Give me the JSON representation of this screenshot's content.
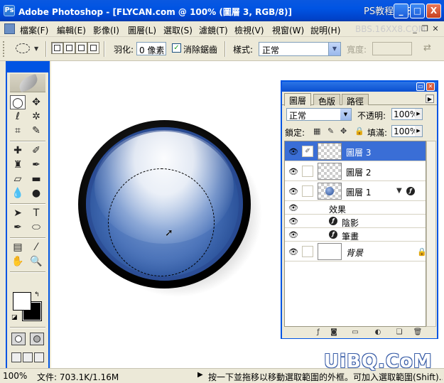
{
  "window": {
    "title": "Adobe Photoshop - [FLYCAN.com @ 100% (圖層 3, RGB/8)]",
    "app_icon": "Ps",
    "minimize": "_",
    "maximize": "□",
    "close": "X"
  },
  "watermarks": {
    "top": "PS教程论坛",
    "bbs": "BBS.16XX8.COM",
    "bottom": "UiBQ.CoM"
  },
  "menu": {
    "items": [
      "檔案(F)",
      "編輯(E)",
      "影像(I)",
      "圖層(L)",
      "選取(S)",
      "濾鏡(T)",
      "檢視(V)",
      "視窗(W)",
      "說明(H)"
    ]
  },
  "options": {
    "feather_label": "羽化:",
    "feather_value": "0 像素",
    "antialias_label": "消除鋸齒",
    "antialias_checked": true,
    "style_label": "樣式:",
    "style_value": "正常",
    "width_label": "寬度:",
    "width_value": ""
  },
  "layers_panel": {
    "tabs": [
      "圖層",
      "色版",
      "路徑"
    ],
    "active_tab": "圖層",
    "blend_mode": "正常",
    "opacity_label": "不透明:",
    "opacity_value": "100%",
    "lock_label": "鎖定:",
    "fill_label": "填滿:",
    "fill_value": "100%",
    "layers": [
      {
        "name": "圖層 3",
        "selected": true,
        "visible": true
      },
      {
        "name": "圖層 2",
        "selected": false,
        "visible": true
      },
      {
        "name": "圖層 1",
        "selected": false,
        "visible": true,
        "has_effects": true
      },
      {
        "name": "效果",
        "type": "effects-header"
      },
      {
        "name": "陰影",
        "type": "effect"
      },
      {
        "name": "筆畫",
        "type": "effect"
      },
      {
        "name": "背景",
        "selected": false,
        "visible": true,
        "locked": true
      }
    ]
  },
  "status": {
    "zoom": "100%",
    "doc_size": "文件: 703.1K/1.16M",
    "hint": "按一下並拖移以移動選取範圍的外框。可加入選取範圍(Shift)..."
  },
  "colors": {
    "title_bar": "#0054e3",
    "selected_layer": "#3a6ed6",
    "orb_blue": "#456fb6"
  }
}
